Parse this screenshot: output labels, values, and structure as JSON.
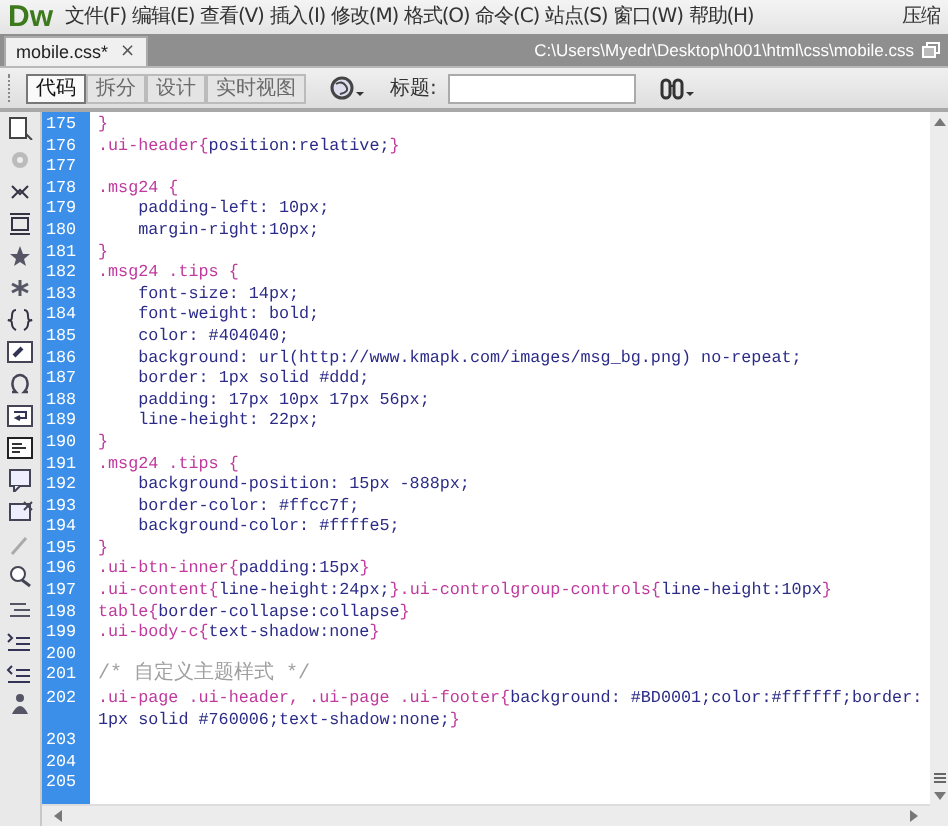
{
  "app": {
    "logo": "Dw",
    "menu": [
      "文件(F)",
      "编辑(E)",
      "查看(V)",
      "插入(I)",
      "修改(M)",
      "格式(O)",
      "命令(C)",
      "站点(S)",
      "窗口(W)",
      "帮助(H)"
    ],
    "layout_switch": "压缩"
  },
  "document_tab": {
    "label": "mobile.css*",
    "close": "×",
    "path": "C:\\Users\\Myedr\\Desktop\\h001\\html\\css\\mobile.css"
  },
  "view_buttons": [
    {
      "label": "代码",
      "selected": true
    },
    {
      "label": "拆分",
      "selected": false
    },
    {
      "label": "设计",
      "selected": false
    },
    {
      "label": "实时视图",
      "selected": false
    }
  ],
  "title_field": {
    "label": "标题:"
  },
  "code_lines": [
    {
      "number": "175",
      "segments": [
        {
          "kind": "sel",
          "text": "}"
        }
      ]
    },
    {
      "number": "176",
      "segments": [
        {
          "kind": "sel",
          "text": ".ui-header{"
        },
        {
          "kind": "decl",
          "text": "position:relative;"
        },
        {
          "kind": "sel",
          "text": "}"
        }
      ]
    },
    {
      "number": "177"
    },
    {
      "number": "178",
      "segments": [
        {
          "kind": "sel",
          "text": ".msg24 {"
        }
      ]
    },
    {
      "number": "179",
      "segments": [
        {
          "kind": "decl",
          "text": "    padding-left: 10px;"
        }
      ]
    },
    {
      "number": "180",
      "segments": [
        {
          "kind": "decl",
          "text": "    margin-right:10px;"
        }
      ]
    },
    {
      "number": "181",
      "segments": [
        {
          "kind": "sel",
          "text": "}"
        }
      ]
    },
    {
      "number": "182",
      "segments": [
        {
          "kind": "sel",
          "text": ".msg24 .tips {"
        }
      ]
    },
    {
      "number": "183",
      "segments": [
        {
          "kind": "decl",
          "text": "    font-size: 14px;"
        }
      ]
    },
    {
      "number": "184",
      "segments": [
        {
          "kind": "decl",
          "text": "    font-weight: bold;"
        }
      ]
    },
    {
      "number": "185",
      "segments": [
        {
          "kind": "decl",
          "text": "    color: #404040;"
        }
      ]
    },
    {
      "number": "186",
      "segments": [
        {
          "kind": "decl",
          "text": "    background: url(http://www.kmapk.com/images/msg_bg.png) no-repeat;"
        }
      ]
    },
    {
      "number": "187",
      "segments": [
        {
          "kind": "decl",
          "text": "    border: 1px solid #ddd;"
        }
      ]
    },
    {
      "number": "188",
      "segments": [
        {
          "kind": "decl",
          "text": "    padding: 17px 10px 17px 56px;"
        }
      ]
    },
    {
      "number": "189",
      "segments": [
        {
          "kind": "decl",
          "text": "    line-height: 22px;"
        }
      ]
    },
    {
      "number": "190",
      "segments": [
        {
          "kind": "sel",
          "text": "}"
        }
      ]
    },
    {
      "number": "191",
      "segments": [
        {
          "kind": "sel",
          "text": ".msg24 .tips {"
        }
      ]
    },
    {
      "number": "192",
      "segments": [
        {
          "kind": "decl",
          "text": "    background-position: 15px -888px;"
        }
      ]
    },
    {
      "number": "193",
      "segments": [
        {
          "kind": "decl",
          "text": "    border-color: #ffcc7f;"
        }
      ]
    },
    {
      "number": "194",
      "segments": [
        {
          "kind": "decl",
          "text": "    background-color: #ffffe5;"
        }
      ]
    },
    {
      "number": "195",
      "segments": [
        {
          "kind": "sel",
          "text": "}"
        }
      ]
    },
    {
      "number": "196",
      "segments": [
        {
          "kind": "sel",
          "text": ".ui-btn-inner{"
        },
        {
          "kind": "decl",
          "text": "padding:15px"
        },
        {
          "kind": "sel",
          "text": "}"
        }
      ]
    },
    {
      "number": "197",
      "segments": [
        {
          "kind": "sel",
          "text": ".ui-content{"
        },
        {
          "kind": "decl",
          "text": "line-height:24px;"
        },
        {
          "kind": "sel",
          "text": "}.ui-controlgroup-controls{"
        },
        {
          "kind": "decl",
          "text": "line-height:10px"
        },
        {
          "kind": "sel",
          "text": "}"
        }
      ]
    },
    {
      "number": "198",
      "segments": [
        {
          "kind": "sel",
          "text": "table{"
        },
        {
          "kind": "decl",
          "text": "border-collapse:collapse"
        },
        {
          "kind": "sel",
          "text": "}"
        }
      ]
    },
    {
      "number": "199",
      "segments": [
        {
          "kind": "sel",
          "text": ".ui-body-c{"
        },
        {
          "kind": "decl",
          "text": "text-shadow:none"
        },
        {
          "kind": "sel",
          "text": "}"
        }
      ]
    },
    {
      "number": "200"
    },
    {
      "number": "201",
      "segments": [
        {
          "kind": "comment",
          "text": "/* 自定义主题样式 */"
        }
      ]
    },
    {
      "number": "202",
      "segments": [
        {
          "kind": "sel",
          "text": ".ui-page .ui-header, .ui-page .ui-footer{"
        },
        {
          "kind": "decl",
          "text": "background: #BD0001;color:#ffffff;border: 1px solid #760006;text-shadow:none;"
        },
        {
          "kind": "sel",
          "text": "}"
        }
      ]
    },
    {
      "number": "203"
    },
    {
      "number": "204"
    },
    {
      "number": "205"
    }
  ]
}
